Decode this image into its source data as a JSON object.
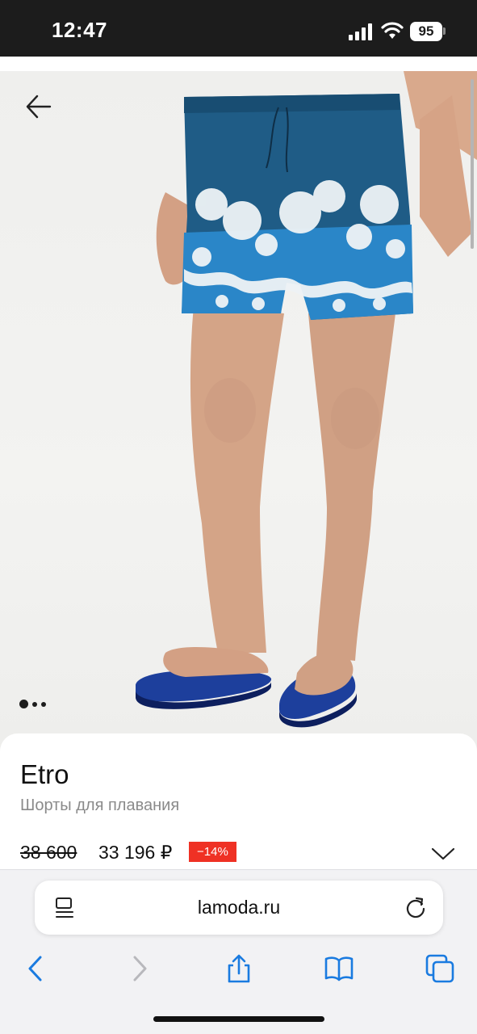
{
  "status_bar": {
    "time": "12:47",
    "battery": "95",
    "icons": [
      "cellular-signal-icon",
      "wifi-icon",
      "battery-icon"
    ]
  },
  "product": {
    "brand": "Etro",
    "type": "Шорты для плавания",
    "old_price": "38 600",
    "new_price": "33 196 ₽",
    "discount": "−14%",
    "image_count": 3,
    "active_image": 1
  },
  "browser": {
    "address": "lamoda.ru",
    "icons": [
      "reader-icon",
      "reload-icon",
      "back-icon",
      "forward-icon",
      "share-icon",
      "bookmarks-icon",
      "tabs-icon"
    ]
  },
  "colors": {
    "accent_blue": "#1a7be0",
    "discount_red": "#ef3124",
    "shorts_navy": "#1f5c86"
  }
}
